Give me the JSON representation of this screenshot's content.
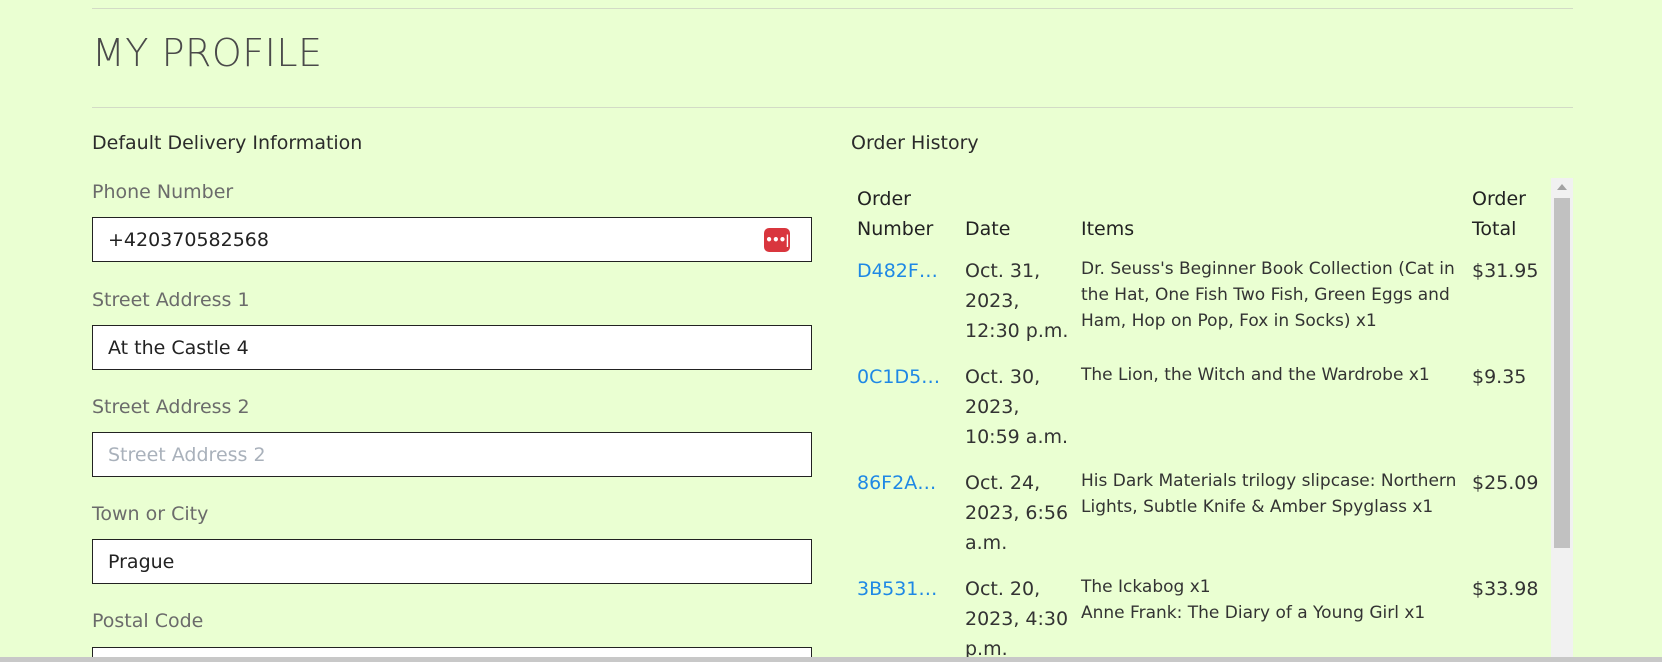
{
  "page_title": "MY PROFILE",
  "delivery": {
    "heading": "Default Delivery Information",
    "phone": {
      "label": "Phone Number",
      "value": "+420370582568",
      "icon": "password-manager-icon"
    },
    "street1": {
      "label": "Street Address 1",
      "value": "At the Castle 4"
    },
    "street2": {
      "label": "Street Address 2",
      "placeholder": "Street Address 2"
    },
    "town": {
      "label": "Town or City",
      "value": "Prague"
    },
    "postal": {
      "label": "Postal Code"
    }
  },
  "orders": {
    "heading": "Order History",
    "columns": {
      "number": "Order Number",
      "date": "Date",
      "items": "Items",
      "total": "Order Total"
    },
    "rows": [
      {
        "number": "D482F…",
        "date": "Oct. 31, 2023, 12:30 p.m.",
        "items": [
          "Dr. Seuss's Beginner Book Collection (Cat in the Hat, One Fish Two Fish, Green Eggs and Ham, Hop on Pop, Fox in Socks) x1"
        ],
        "total": "$31.95"
      },
      {
        "number": "0C1D5…",
        "date": "Oct. 30, 2023, 10:59 a.m.",
        "items": [
          "The Lion, the Witch and the Wardrobe x1"
        ],
        "total": "$9.35"
      },
      {
        "number": "86F2A…",
        "date": "Oct. 24, 2023, 6:56 a.m.",
        "items": [
          "His Dark Materials trilogy slipcase: Northern Lights, Subtle Knife & Amber Spyglass x1"
        ],
        "total": "$25.09"
      },
      {
        "number": "3B531…",
        "date": "Oct. 20, 2023, 4:30 p.m.",
        "items": [
          "The Ickabog x1",
          "Anne Frank: The Diary of a Young Girl x1"
        ],
        "total": "$33.98"
      }
    ]
  },
  "colors": {
    "background": "#eaffd2",
    "link": "#1e88e5",
    "password_icon": "#d9363e"
  }
}
